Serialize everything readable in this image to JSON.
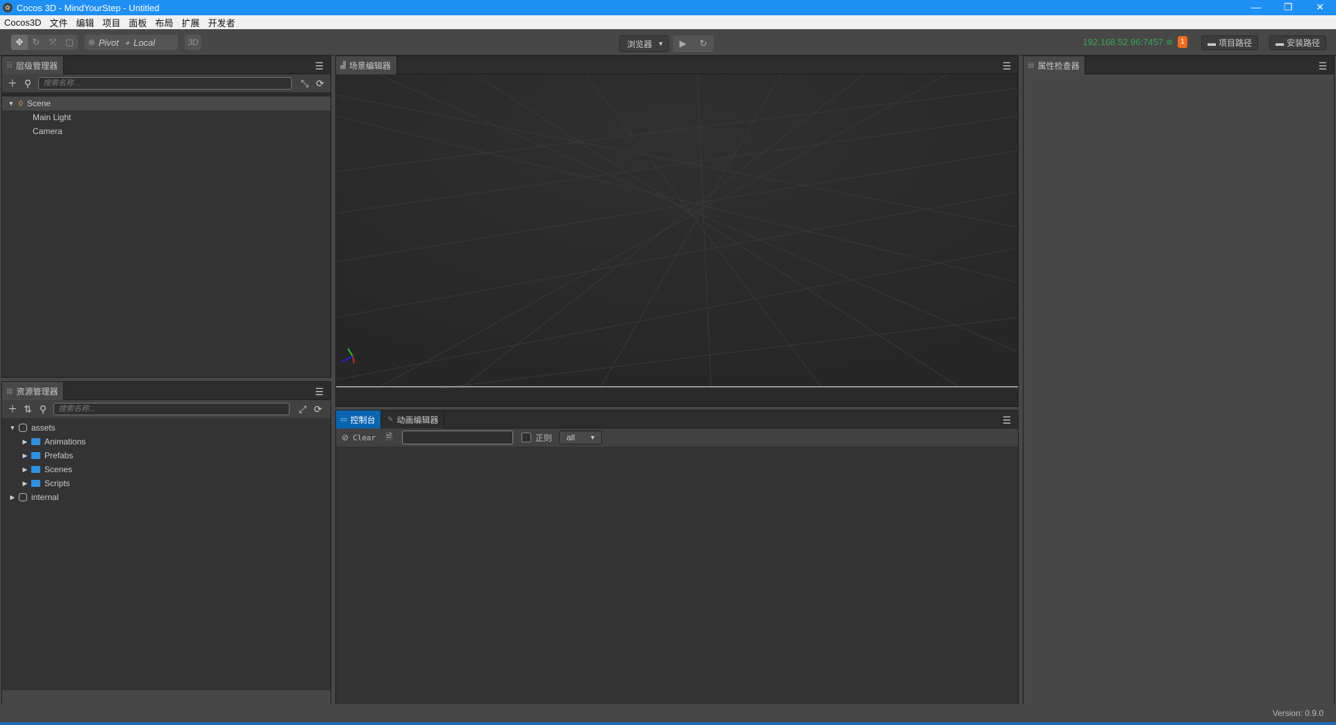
{
  "window": {
    "title": "Cocos 3D - MindYourStep - Untitled",
    "controls": [
      "—",
      "❐",
      "✕"
    ]
  },
  "menu": [
    "Cocos3D",
    "文件",
    "编辑",
    "项目",
    "面板",
    "布局",
    "扩展",
    "开发者"
  ],
  "toolbar": {
    "transform_tools": [
      "move-tool",
      "rotate-tool",
      "scale-tool",
      "rect-tool"
    ],
    "pivot_label": "Pivot",
    "local_label": "Local",
    "mode_label": "3D",
    "preview_select": "浏览器",
    "ip": "192.168.52.96:7457",
    "notification_count": "1",
    "project_path_label": "项目路径",
    "install_path_label": "安装路径"
  },
  "hierarchy": {
    "title": "层级管理器",
    "search_placeholder": "搜索名称...",
    "root": "Scene",
    "children": [
      "Main Light",
      "Camera"
    ]
  },
  "assets": {
    "title": "资源管理器",
    "search_placeholder": "搜索名称...",
    "root": "assets",
    "folders": [
      "Animations",
      "Prefabs",
      "Scenes",
      "Scripts"
    ],
    "other_root": "internal"
  },
  "scene": {
    "title": "场景编辑器"
  },
  "console": {
    "tab_console": "控制台",
    "tab_animation": "动画编辑器",
    "clear_label": "Clear",
    "regex_label": "正则",
    "filter_value": "all",
    "filter_input": ""
  },
  "inspector": {
    "title": "属性检查器"
  },
  "status": {
    "version": "Version: 0.9.0"
  },
  "colors": {
    "accent": "#1e8ff5",
    "tab_active": "#0a65b0",
    "ip_green": "#35a853",
    "badge": "#ef6b1c",
    "folder": "#2f91e3"
  }
}
